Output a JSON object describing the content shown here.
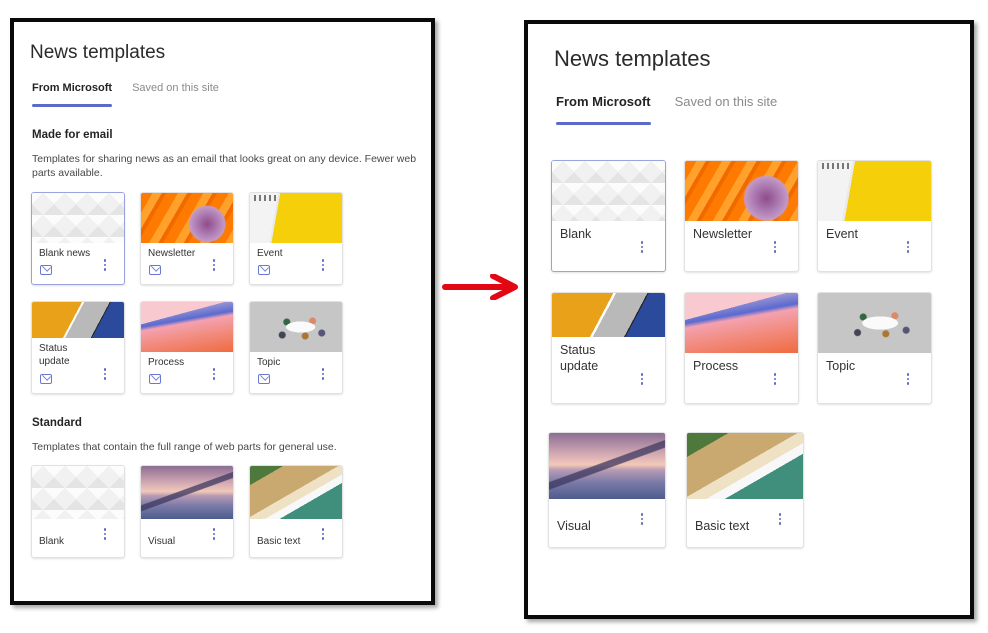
{
  "before": {
    "title": "News templates",
    "tabs": [
      {
        "label": "From Microsoft",
        "active": true
      },
      {
        "label": "Saved on this site",
        "active": false
      }
    ],
    "sections": [
      {
        "title": "Made for email",
        "description": "Templates for sharing news as an email that looks great on any device. Fewer web parts available.",
        "cards": [
          {
            "label": "Blank news",
            "icon": "mail-icon",
            "thumbnail": "blank-pattern",
            "selected": true
          },
          {
            "label": "Newsletter",
            "icon": "mail-icon",
            "thumbnail": "orange-shell"
          },
          {
            "label": "Event",
            "icon": "mail-icon",
            "thumbnail": "calendar-yellow"
          },
          {
            "label": "Status update",
            "icon": "mail-icon",
            "thumbnail": "diagonal-stripes"
          },
          {
            "label": "Process",
            "icon": "mail-icon",
            "thumbnail": "pink-wave"
          },
          {
            "label": "Topic",
            "icon": "mail-icon",
            "thumbnail": "meeting-table"
          }
        ]
      },
      {
        "title": "Standard",
        "description": "Templates that contain the full range of web parts for general use.",
        "cards": [
          {
            "label": "Blank",
            "thumbnail": "blank-pattern"
          },
          {
            "label": "Visual",
            "thumbnail": "lake-reflection"
          },
          {
            "label": "Basic text",
            "thumbnail": "beach-aerial"
          }
        ]
      }
    ]
  },
  "arrow": {
    "icon": "right-arrow-icon",
    "color": "#e30613"
  },
  "after": {
    "title": "News templates",
    "tabs": [
      {
        "label": "From Microsoft",
        "active": true
      },
      {
        "label": "Saved on this site",
        "active": false
      }
    ],
    "cards": [
      {
        "label": "Blank",
        "thumbnail": "blank-pattern",
        "selected": true
      },
      {
        "label": "Newsletter",
        "thumbnail": "orange-shell"
      },
      {
        "label": "Event",
        "thumbnail": "calendar-yellow"
      },
      {
        "label": "Status update",
        "thumbnail": "diagonal-stripes"
      },
      {
        "label": "Process",
        "thumbnail": "pink-wave"
      },
      {
        "label": "Topic",
        "thumbnail": "meeting-table"
      },
      {
        "label": "Visual",
        "thumbnail": "lake-reflection"
      },
      {
        "label": "Basic text",
        "thumbnail": "beach-aerial"
      }
    ]
  },
  "colors": {
    "accent": "#5b6bc8",
    "selected_border": "#9aa3e0",
    "frame_border": "#0a0a0a",
    "arrow": "#e30613"
  }
}
